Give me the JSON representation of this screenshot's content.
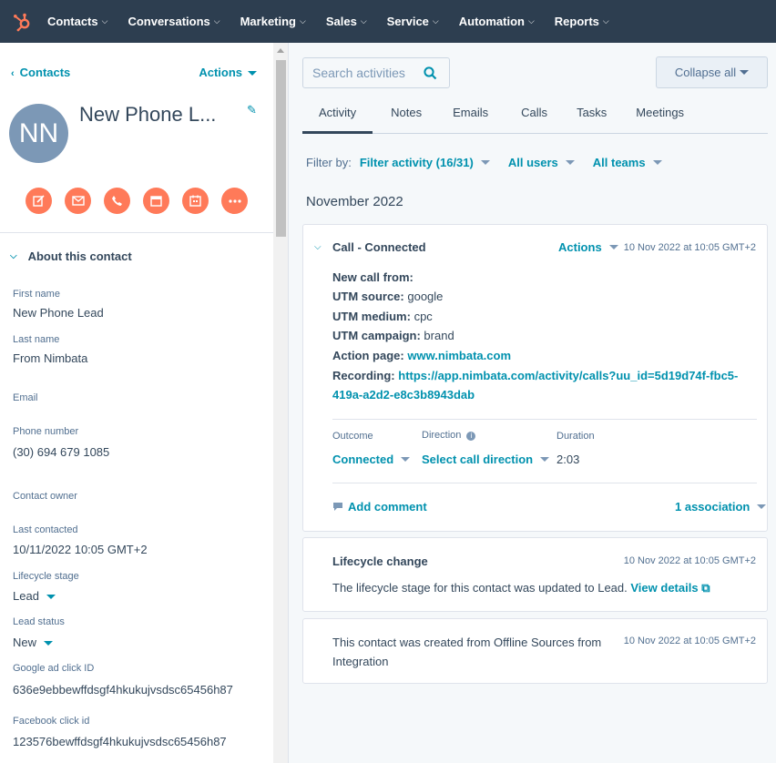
{
  "nav": {
    "logo_icon": "hubspot-sprocket-icon",
    "items": [
      {
        "label": "Contacts"
      },
      {
        "label": "Conversations"
      },
      {
        "label": "Marketing"
      },
      {
        "label": "Sales"
      },
      {
        "label": "Service"
      },
      {
        "label": "Automation"
      },
      {
        "label": "Reports"
      }
    ]
  },
  "contact": {
    "back_label": "Contacts",
    "actions_label": "Actions",
    "initials": "NN",
    "name": "New Phone L...",
    "action_icons": [
      "note-icon",
      "email-icon",
      "call-icon",
      "log-icon",
      "meeting-icon",
      "more-icon"
    ]
  },
  "about": {
    "title": "About this contact",
    "fields": [
      {
        "label": "First name",
        "value": "New Phone Lead"
      },
      {
        "label": "Last name",
        "value": "From Nimbata"
      },
      {
        "label": "Email",
        "value": ""
      },
      {
        "label": "Phone number",
        "value": "(30) 694 679 1085"
      },
      {
        "label": "Contact owner",
        "value": ""
      },
      {
        "label": "Last contacted",
        "value": "10/11/2022 10:05 GMT+2"
      },
      {
        "label": "Lifecycle stage",
        "value": "Lead"
      },
      {
        "label": "Lead status",
        "value": "New"
      },
      {
        "label": "Google ad click ID",
        "value": "636e9ebbewffdsgf4hkukujvsdsc65456h87"
      },
      {
        "label": "Facebook click id",
        "value": "123576bewffdsgf4hkukujvsdsc65456h87"
      }
    ]
  },
  "timeline": {
    "search_placeholder": "Search activities",
    "collapse_label": "Collapse all",
    "tabs": [
      "Activity",
      "Notes",
      "Emails",
      "Calls",
      "Tasks",
      "Meetings"
    ],
    "filter_by": "Filter by:",
    "filter_activity": "Filter activity (16/31)",
    "all_users": "All users",
    "all_teams": "All teams",
    "month": "November 2022",
    "call_card": {
      "title": "Call - Connected",
      "actions": "Actions",
      "timestamp": "10 Nov 2022 at 10:05 GMT+2",
      "new_call": "New call from:",
      "utm_source_label": "UTM source:",
      "utm_source": "google",
      "utm_medium_label": "UTM medium:",
      "utm_medium": "cpc",
      "utm_campaign_label": "UTM campaign:",
      "utm_campaign": "brand",
      "action_page_label": "Action page:",
      "action_page": "www.nimbata.com",
      "recording_label": "Recording:",
      "recording_line1": "https://app.nimbata.com/activity/calls?uu_id=5d19d74f-fbc5-",
      "recording_line2": "419a-a2d2-e8c3b8943dab",
      "outcome_label": "Outcome",
      "outcome": "Connected",
      "direction_label": "Direction",
      "direction": "Select call direction",
      "duration_label": "Duration",
      "duration": "2:03",
      "add_comment": "Add comment",
      "association": "1 association"
    },
    "lifecycle_card": {
      "title": "Lifecycle change",
      "timestamp": "10 Nov 2022 at 10:05 GMT+2",
      "text": "The lifecycle stage for this contact was updated to Lead.",
      "link": "View details"
    },
    "created_card": {
      "text_line1": "This contact was created from Offline Sources from",
      "text_line2": "Integration",
      "timestamp": "10 Nov 2022 at 10:05 GMT+2"
    }
  }
}
